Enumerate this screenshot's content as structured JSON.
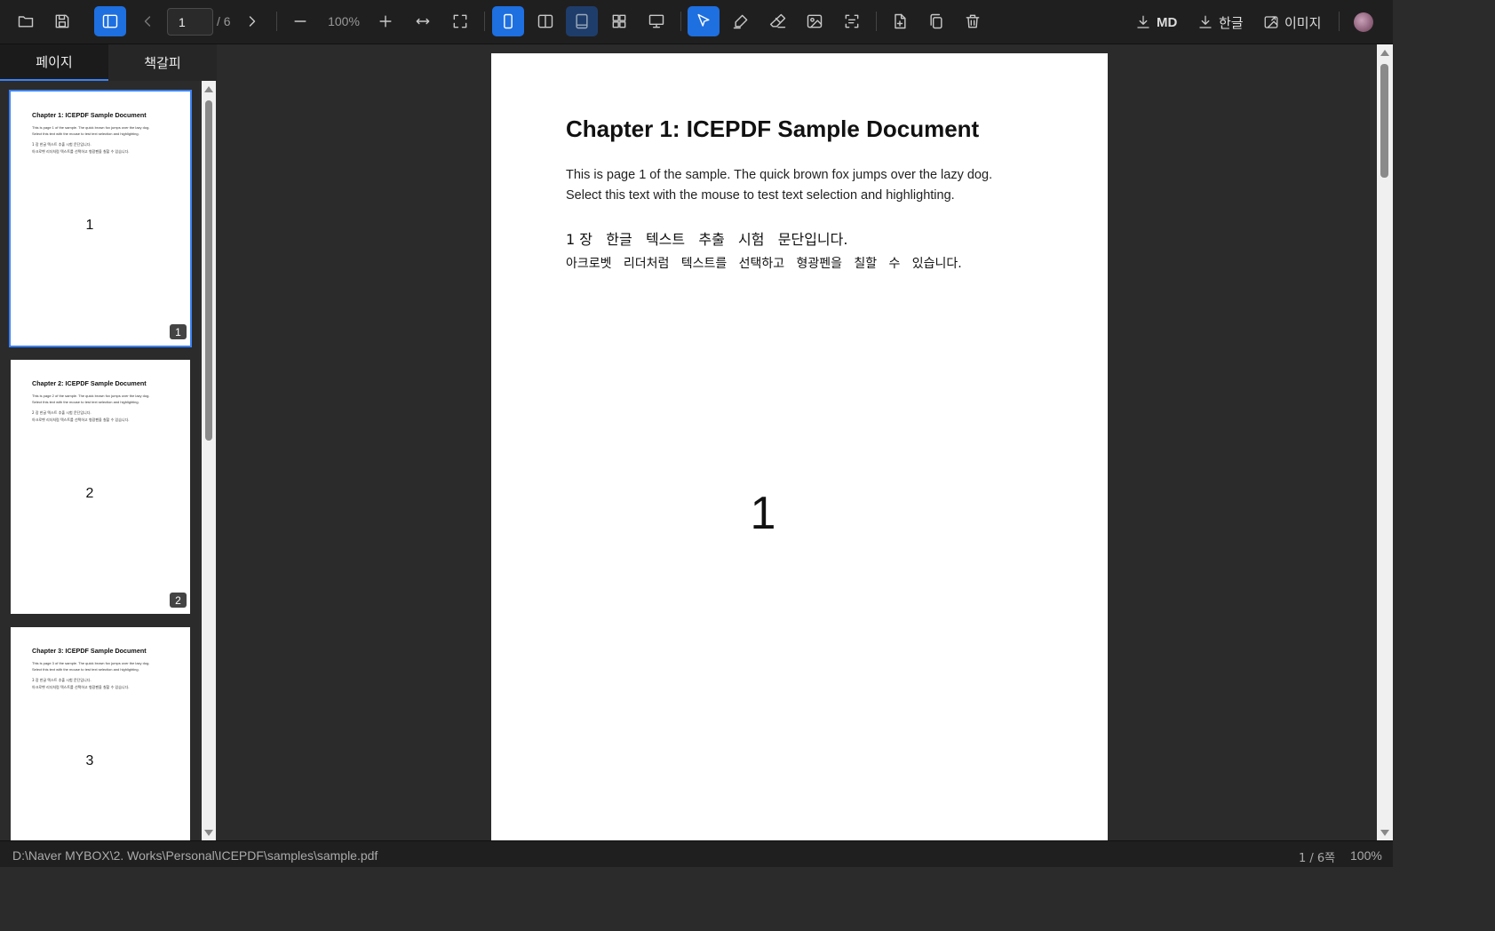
{
  "toolbar": {
    "page_current": "1",
    "page_total": "/ 6",
    "zoom": "100%",
    "download_md": "MD",
    "download_hangul": "한글",
    "download_image": "이미지",
    "accent_color": "#1e6fe0"
  },
  "sidebar": {
    "tabs": [
      {
        "label": "페이지",
        "active": true
      },
      {
        "label": "책갈피",
        "active": false
      }
    ],
    "thumbnails": [
      {
        "title": "Chapter 1: ICEPDF Sample Document",
        "line1": "This is page 1 of the sample. The quick brown fox jumps over the lazy dog.",
        "line2": "Select this text with the mouse to test text selection and highlighting.",
        "kr1": "1 장   한글   텍스트   추출   시험   문단입니다.",
        "kr2": "아크로벳   리더처럼   텍스트를   선택하고   형광펜을   칠할   수   있습니다.",
        "number": "1",
        "badge": "1",
        "selected": true
      },
      {
        "title": "Chapter 2: ICEPDF Sample Document",
        "line1": "This is page 2 of the sample. The quick brown fox jumps over the lazy dog.",
        "line2": "Select this text with the mouse to test text selection and highlighting.",
        "kr1": "2 장   한글   텍스트   추출   시험   문단입니다.",
        "kr2": "아크로벳   리더처럼   텍스트를   선택하고   형광펜을   칠할   수   있습니다.",
        "number": "2",
        "badge": "2",
        "selected": false
      },
      {
        "title": "Chapter 3: ICEPDF Sample Document",
        "line1": "This is page 3 of the sample. The quick brown fox jumps over the lazy dog.",
        "line2": "Select this text with the mouse to test text selection and highlighting.",
        "kr1": "3 장   한글   텍스트   추출   시험   문단입니다.",
        "kr2": "아크로벳   리더처럼   텍스트를   선택하고   형광펜을   칠할   수   있습니다.",
        "number": "3",
        "badge": "",
        "selected": false
      }
    ]
  },
  "document": {
    "title": "Chapter 1: ICEPDF Sample Document",
    "line1": "This is page 1 of the sample. The quick brown fox jumps over the lazy dog.",
    "line2": "Select this text with the mouse to test text selection and highlighting.",
    "kr1": "1 장   한글   텍스트   추출   시험   문단입니다.",
    "kr2": "아크로벳   리더처럼   텍스트를   선택하고   형광펜을   칠할   수   있습니다.",
    "page_number": "1"
  },
  "statusbar": {
    "path": "D:\\Naver MYBOX\\2. Works\\Personal\\ICEPDF\\samples\\sample.pdf",
    "page": "1 / 6쪽",
    "zoom": "100%"
  }
}
